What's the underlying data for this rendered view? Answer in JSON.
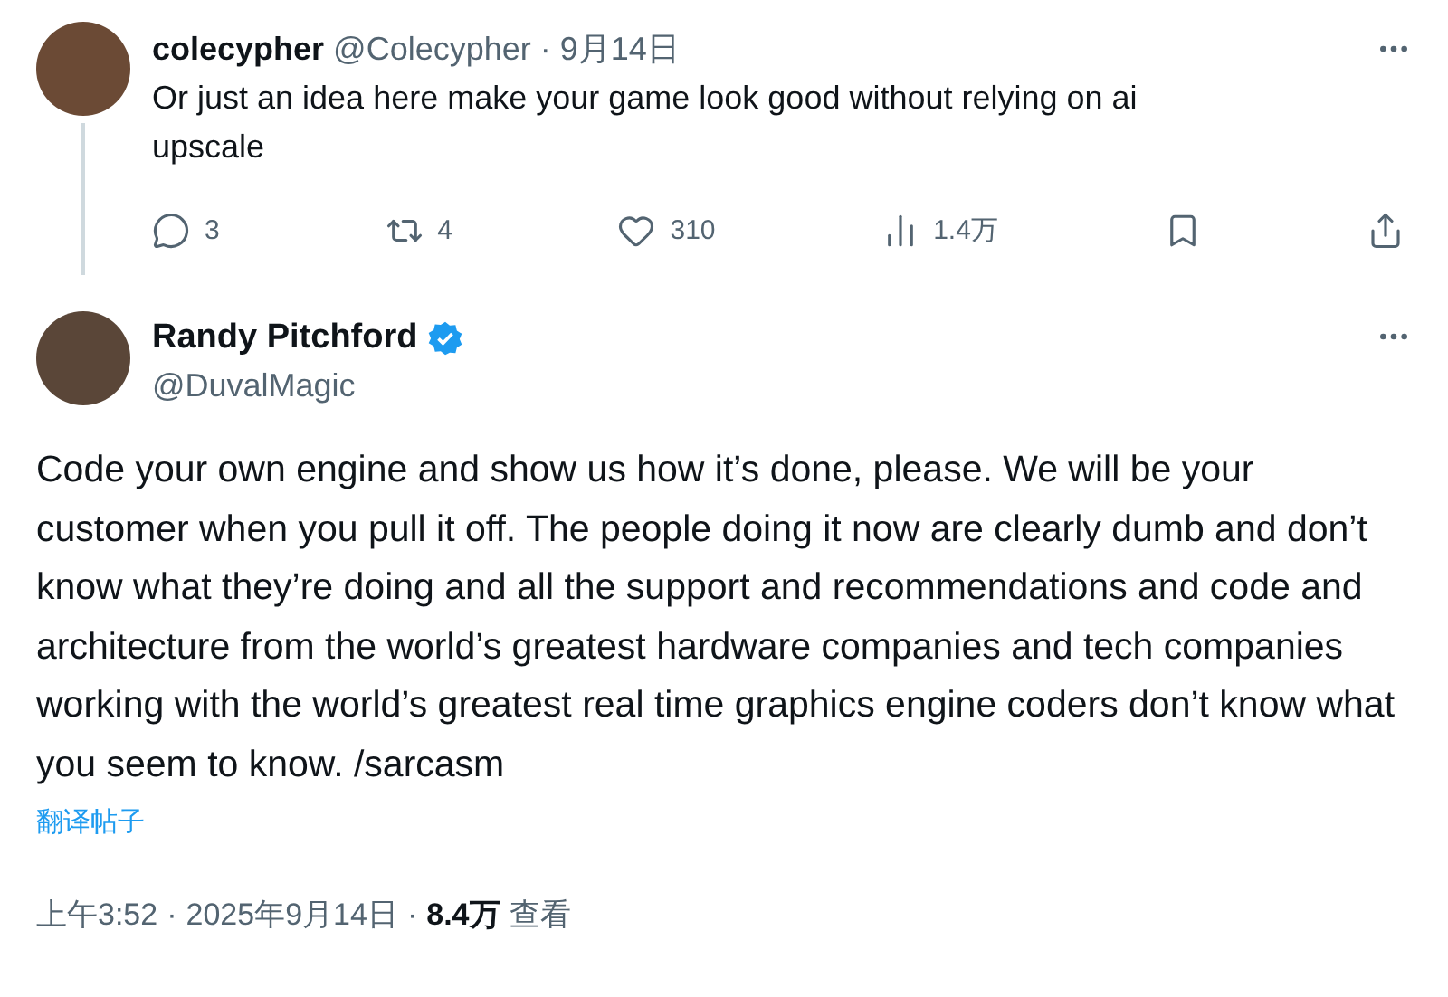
{
  "reply_post": {
    "author_name": "colecypher",
    "handle": "@Colecypher",
    "separator": "·",
    "date": "9月14日",
    "text": "Or just an idea here make your game look good without relying on ai upscale",
    "actions": [
      {
        "kind": "reply",
        "count": "3"
      },
      {
        "kind": "repost",
        "count": "4"
      },
      {
        "kind": "like",
        "count": "310"
      },
      {
        "kind": "views",
        "count": "1.4万"
      },
      {
        "kind": "bookmark"
      },
      {
        "kind": "share"
      }
    ]
  },
  "main_post": {
    "author_name": "Randy Pitchford",
    "verified": true,
    "handle": "@DuvalMagic",
    "text": "Code your own engine and show us how it’s done, please.  We will be your customer when you pull it off. The people doing it now are clearly dumb and don’t know what they’re doing and all the support and recommendations and code and architecture from the world’s greatest hardware companies and tech companies working with the world’s greatest real time graphics engine coders don’t know what you seem to know. /sarcasm",
    "translate_link": "翻译帖子",
    "time": "上午3:52",
    "separator_1": "·",
    "date": "2025年9月14日",
    "separator_2": "·",
    "views_count": "8.4万",
    "views_label": "查看"
  }
}
